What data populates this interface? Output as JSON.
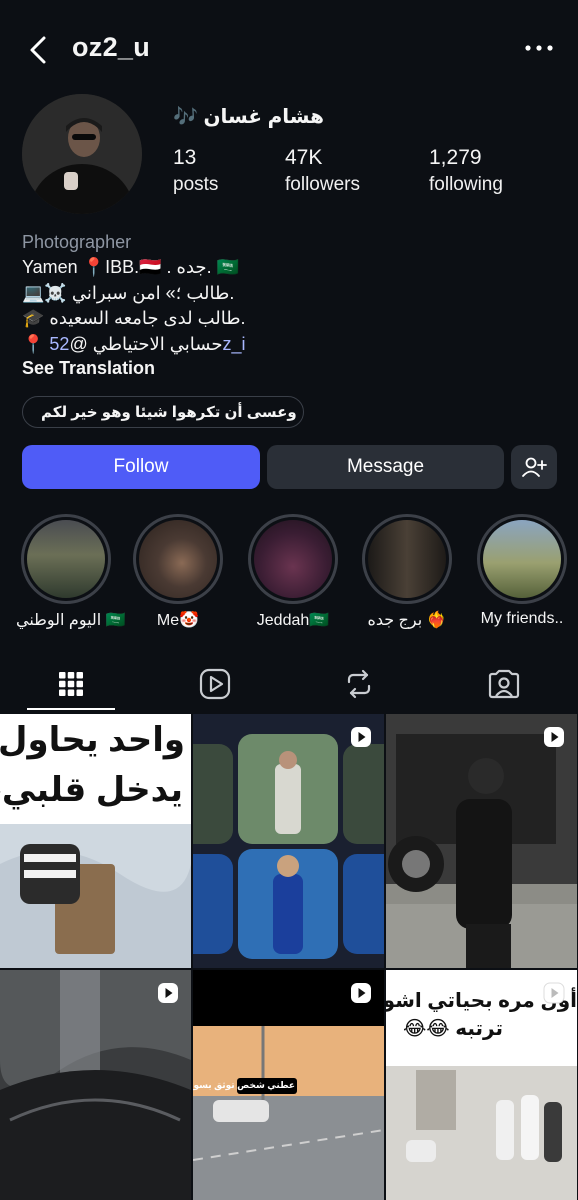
{
  "header": {
    "username": "oz2_u"
  },
  "profile": {
    "display_name": "هشام غسان 🎶",
    "stats": [
      {
        "value": "13",
        "label": "posts"
      },
      {
        "value": "47K",
        "label": "followers"
      },
      {
        "value": "1,279",
        "label": "following"
      }
    ],
    "category": "Photographer",
    "bio_lines": [
      "Yamen 📍IBB.🇾🇪 . جده. 🇸🇦",
      "💻☠️ طالب ؛» امن سبراني.",
      "🎓 طالب لدى جامعه السعيده.",
      "📍 حسابي الاحتياطي @"
    ],
    "bio_mention": "52z_i",
    "see_translation": "See Translation",
    "note_text": "وعسى أن تكرهوا شيئا وهو خير لكم"
  },
  "actions": {
    "follow": "Follow",
    "message": "Message"
  },
  "highlights": [
    {
      "label": "اليوم الوطني 🇸🇦"
    },
    {
      "label": "Me🤡"
    },
    {
      "label": "Jeddah🇸🇦"
    },
    {
      "label": "برج جده ❤️‍🔥"
    },
    {
      "label": "My friends.."
    }
  ],
  "grid_texts": {
    "post1_line1": "واحد يحاول",
    "post1_line2": "يدخل قلبي😂",
    "post6_line1": "أول مره بحياتي اشوف طير",
    "post6_line2": "ترتبه 😂😂",
    "post5_caption": "عطني شخص توثق بسواقت؟"
  },
  "colors": {
    "background": "#0c0f14",
    "follow_button": "#4f5cf7",
    "secondary_button": "#2a2f37",
    "mention": "#a9b8ff"
  }
}
